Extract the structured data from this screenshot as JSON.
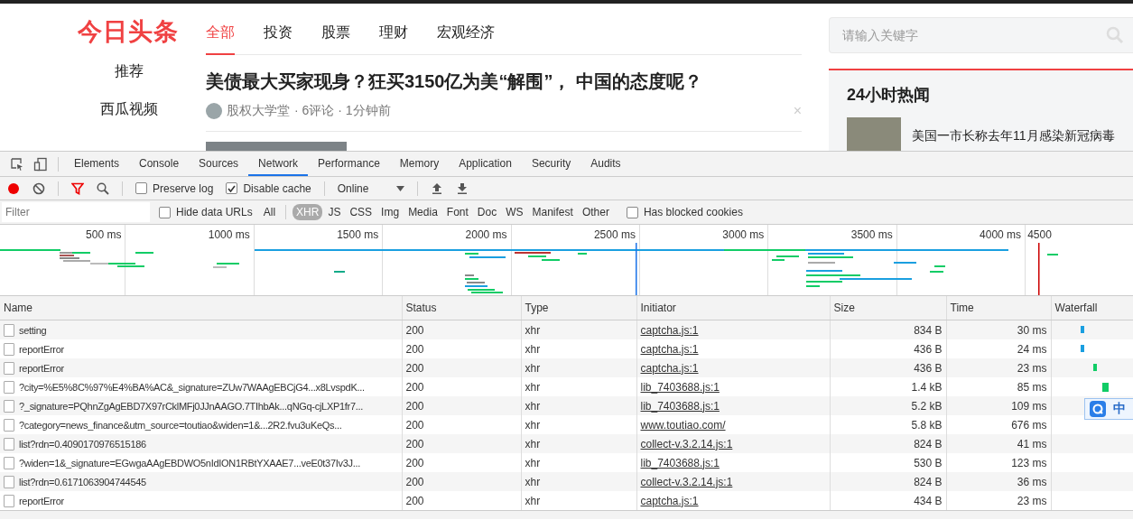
{
  "news": {
    "logo": "今日头条",
    "channel_tabs": [
      {
        "label": "全部",
        "selected": true
      },
      {
        "label": "投资",
        "selected": false
      },
      {
        "label": "股票",
        "selected": false
      },
      {
        "label": "理财",
        "selected": false
      },
      {
        "label": "宏观经济",
        "selected": false
      }
    ],
    "side_nav": [
      "推荐",
      "西瓜视频"
    ],
    "article": {
      "headline": "美债最大买家现身？狂买3150亿为美“解围”， 中国的态度呢？",
      "source": "股权大学堂",
      "meta": "· 6评论 · 1分钟前",
      "close": "×"
    },
    "search": {
      "placeholder": "请输入关键字"
    },
    "hot_news": {
      "title": "24小时热闻",
      "items": [
        "美国一市长称去年11月感染新冠病毒"
      ]
    }
  },
  "devtools": {
    "tabs": [
      {
        "label": "Elements",
        "selected": false
      },
      {
        "label": "Console",
        "selected": false
      },
      {
        "label": "Sources",
        "selected": false
      },
      {
        "label": "Network",
        "selected": true
      },
      {
        "label": "Performance",
        "selected": false
      },
      {
        "label": "Memory",
        "selected": false
      },
      {
        "label": "Application",
        "selected": false
      },
      {
        "label": "Security",
        "selected": false
      },
      {
        "label": "Audits",
        "selected": false
      }
    ],
    "toolbar": {
      "recording": true,
      "checkboxes": [
        {
          "label": "Preserve log",
          "checked": false
        },
        {
          "label": "Disable cache",
          "checked": true
        }
      ],
      "throttling": "Online"
    },
    "filter_bar": {
      "placeholder": "Filter",
      "hide_data_urls": {
        "label": "Hide data URLs",
        "checked": false
      },
      "types": [
        {
          "label": "All",
          "selected": false
        },
        {
          "label": "XHR",
          "selected": true
        },
        {
          "label": "JS",
          "selected": false
        },
        {
          "label": "CSS",
          "selected": false
        },
        {
          "label": "Img",
          "selected": false
        },
        {
          "label": "Media",
          "selected": false
        },
        {
          "label": "Font",
          "selected": false
        },
        {
          "label": "Doc",
          "selected": false
        },
        {
          "label": "WS",
          "selected": false
        },
        {
          "label": "Manifest",
          "selected": false
        },
        {
          "label": "Other",
          "selected": false
        }
      ],
      "blocked_cookies": {
        "label": "Has blocked cookies",
        "checked": false
      }
    },
    "overview_ticks": [
      "500 ms",
      "1000 ms",
      "1500 ms",
      "2000 ms",
      "2500 ms",
      "3000 ms",
      "3500 ms",
      "4000 ms",
      "4500"
    ],
    "table": {
      "columns": [
        "Name",
        "Status",
        "Type",
        "Initiator",
        "Size",
        "Time",
        "Waterfall"
      ],
      "rows": [
        {
          "name": "setting",
          "status": "200",
          "type": "xhr",
          "initiator": "captcha.js:1",
          "size": "834 B",
          "time": "30 ms"
        },
        {
          "name": "reportError",
          "status": "200",
          "type": "xhr",
          "initiator": "captcha.js:1",
          "size": "436 B",
          "time": "24 ms"
        },
        {
          "name": "reportError",
          "status": "200",
          "type": "xhr",
          "initiator": "captcha.js:1",
          "size": "436 B",
          "time": "23 ms"
        },
        {
          "name": "?city=%E5%8C%97%E4%BA%AC&_signature=ZUw7WAAgEBCjG4...x8LvspdK...",
          "status": "200",
          "type": "xhr",
          "initiator": "lib_7403688.js:1",
          "size": "1.4 kB",
          "time": "85 ms"
        },
        {
          "name": "?_signature=PQhnZgAgEBD7X97rCklMFj0JJnAAGO.7TIhbAk...qNGq-cjLXP1fr7...",
          "status": "200",
          "type": "xhr",
          "initiator": "lib_7403688.js:1",
          "size": "5.2 kB",
          "time": "109 ms"
        },
        {
          "name": "?category=news_finance&utm_source=toutiao&widen=1&...2R2.fvu3uKeQs...",
          "status": "200",
          "type": "xhr",
          "initiator": "www.toutiao.com/",
          "size": "5.8 kB",
          "time": "676 ms"
        },
        {
          "name": "list?rdn=0.4090170976515186",
          "status": "200",
          "type": "xhr",
          "initiator": "collect-v.3.2.14.js:1",
          "size": "824 B",
          "time": "41 ms"
        },
        {
          "name": "?widen=1&_signature=EGwgaAAgEBDWO5nIdION1RBtYXAAE7...veE0t37Iv3J...",
          "status": "200",
          "type": "xhr",
          "initiator": "lib_7403688.js:1",
          "size": "530 B",
          "time": "123 ms"
        },
        {
          "name": "list?rdn=0.6171063904744545",
          "status": "200",
          "type": "xhr",
          "initiator": "collect-v.3.2.14.js:1",
          "size": "824 B",
          "time": "36 ms"
        },
        {
          "name": "reportError",
          "status": "200",
          "type": "xhr",
          "initiator": "captcha.js:1",
          "size": "434 B",
          "time": "23 ms"
        }
      ]
    },
    "ime_toolbar": {
      "label": "中"
    }
  }
}
